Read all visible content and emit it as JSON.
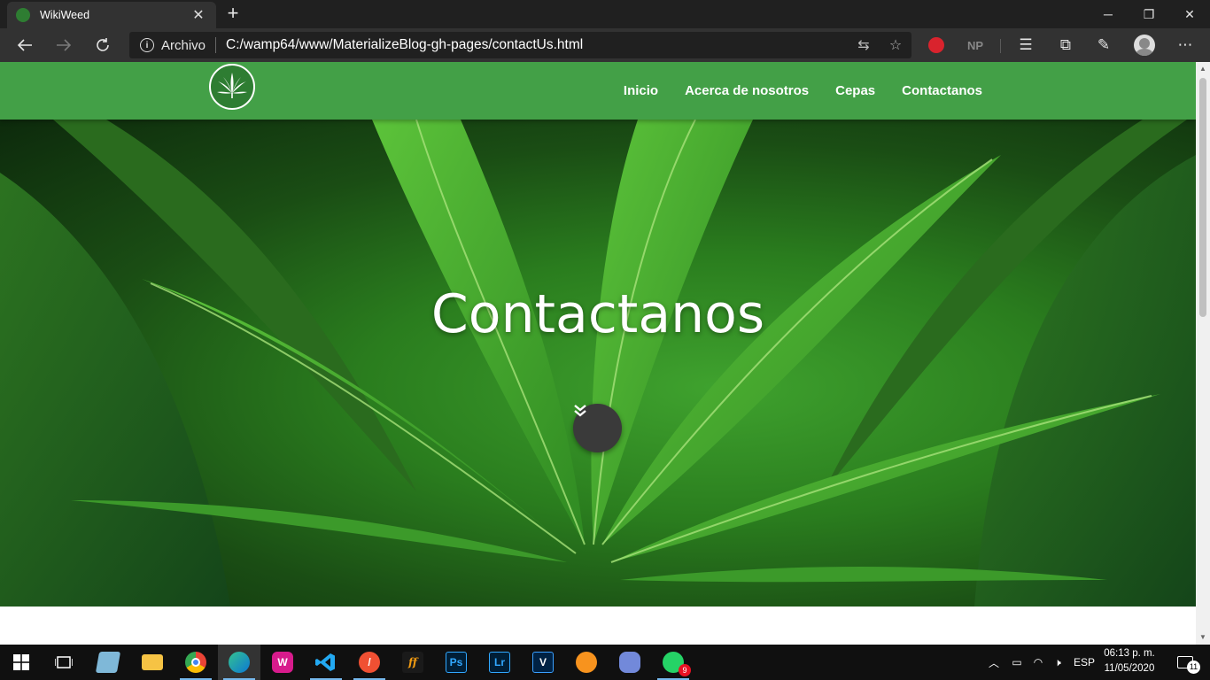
{
  "browser": {
    "tab": {
      "title": "WikiWeed",
      "close": "✕"
    },
    "new_tab": "+",
    "window_controls": {
      "minimize": "─",
      "restore": "❐",
      "close": "✕"
    },
    "address": {
      "scheme_label": "Archivo",
      "url": "C:/wamp64/www/MaterializeBlog-gh-pages/contactUs.html"
    },
    "extension_np": "NP"
  },
  "site": {
    "nav": {
      "items": [
        "Inicio",
        "Acerca de nosotros",
        "Cepas",
        "Contactanos"
      ]
    },
    "hero": {
      "title": "Contactanos"
    }
  },
  "taskbar": {
    "apps": [
      "start-icon",
      "task-view-icon",
      "file-manager-icon",
      "file-explorer-icon",
      "chrome-icon",
      "edge-icon",
      "wamp-icon",
      "vscode-icon",
      "git-icon",
      "fontforge-icon",
      "photoshop-icon",
      "lightroom-icon",
      "vegas-icon",
      "fl-studio-icon",
      "discord-icon",
      "whatsapp-icon"
    ],
    "whatsapp_badge": "9",
    "language": "ESP",
    "time": "06:13 p. m.",
    "date": "11/05/2020",
    "notifications": "11"
  },
  "colors": {
    "nav_green": "#43a047",
    "browser_dark": "#202020",
    "toolbar": "#323232"
  }
}
